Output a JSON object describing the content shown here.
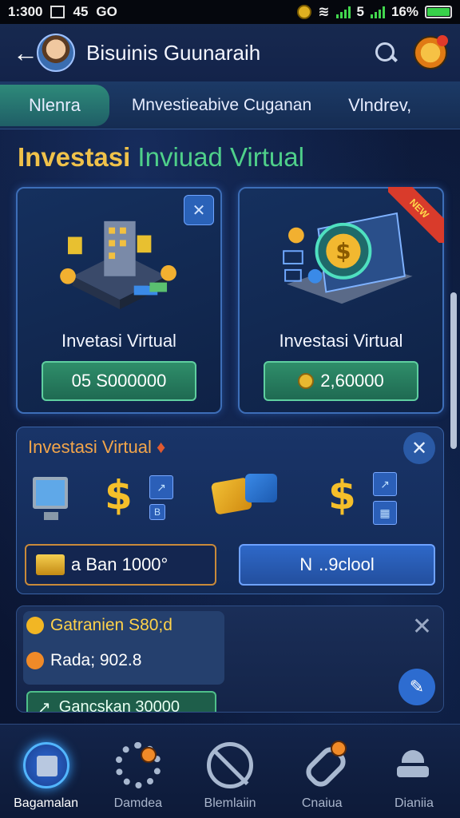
{
  "status_bar": {
    "time": "1:300",
    "left_text": "45",
    "carrier": "GO",
    "signal_text": "5",
    "battery": "16%"
  },
  "header": {
    "title": "Bisuinis Guunaraih",
    "icons": [
      "back-arrow-icon",
      "avatar",
      "search-icon",
      "notification-icon"
    ]
  },
  "tabs": [
    {
      "label": "Nlenra",
      "active": true
    },
    {
      "label": "Mnvestieabive Cuganan",
      "active": false
    },
    {
      "label": "Vlndrev,",
      "active": false
    }
  ],
  "section": {
    "title_a": "Investasi",
    "title_b": "Inviuad Virtual"
  },
  "cards": [
    {
      "label": "Invetasi Virtual",
      "value": "05 S000000",
      "badge_icon": "pin-icon"
    },
    {
      "label": "Investasi Virtual",
      "value": "2,60000",
      "ribbon": "NEW"
    }
  ],
  "panel": {
    "title": "Investasi Virtual",
    "left_button": "a Ban 1000°",
    "right_button": "..9clool",
    "right_button_icon": "N"
  },
  "panel2": {
    "row1": "Gatranien S80;d",
    "row2": "Rada; 902.8",
    "button": "Gancskan 30000"
  },
  "bottom_nav": [
    {
      "label": "Bagamalan",
      "active": true
    },
    {
      "label": "Damdea",
      "active": false
    },
    {
      "label": "Blemlaiin",
      "active": false
    },
    {
      "label": "Cnaiua",
      "active": false
    },
    {
      "label": "Dianiia",
      "active": false
    }
  ],
  "colors": {
    "background": "#0b1530",
    "accent_gold": "#f0c24a",
    "accent_green": "#4fd08a",
    "button_green": "#2f8e6a",
    "button_blue": "#2e68c8"
  }
}
